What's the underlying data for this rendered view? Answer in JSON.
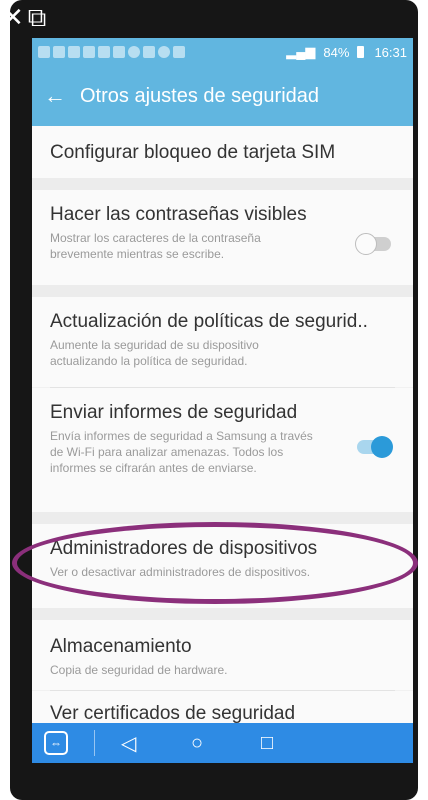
{
  "window_controls": {
    "close_glyph": "✕",
    "popout_glyph": "⧉"
  },
  "statusbar": {
    "icons_text": "◘ ✉ ⊘",
    "signal_text": "84%",
    "time": "16:31"
  },
  "appbar": {
    "back_glyph": "←",
    "title": "Otros ajustes de seguridad"
  },
  "items": [
    {
      "title": "Configurar bloqueo de tarjeta SIM"
    },
    {
      "title": "Hacer las contraseñas visibles",
      "subtitle": "Mostrar los caracteres de la contraseña brevemente mientras se escribe.",
      "toggle": "off"
    },
    {
      "title": "Actualización de políticas de segurid..",
      "subtitle": "Aumente la seguridad de su dispositivo actualizando la política de seguridad."
    },
    {
      "title": "Enviar informes de seguridad",
      "subtitle": "Envía informes de seguridad a Samsung a través de Wi-Fi para analizar amenazas. Todos los informes se cifrarán antes de enviarse.",
      "toggle": "on"
    },
    {
      "title": "Administradores de dispositivos",
      "subtitle": "Ver o desactivar administradores de dispositivos."
    },
    {
      "title": "Almacenamiento",
      "subtitle": "Copia de seguridad de hardware."
    },
    {
      "title": "Ver certificados de seguridad"
    }
  ],
  "navbar": {
    "app_glyph": "⇔",
    "back_glyph": "◁",
    "home_glyph": "○",
    "recents_glyph": "□"
  },
  "colors": {
    "accent": "#61b6e0",
    "nav": "#2e8be4",
    "highlight": "#8b2f7b"
  }
}
